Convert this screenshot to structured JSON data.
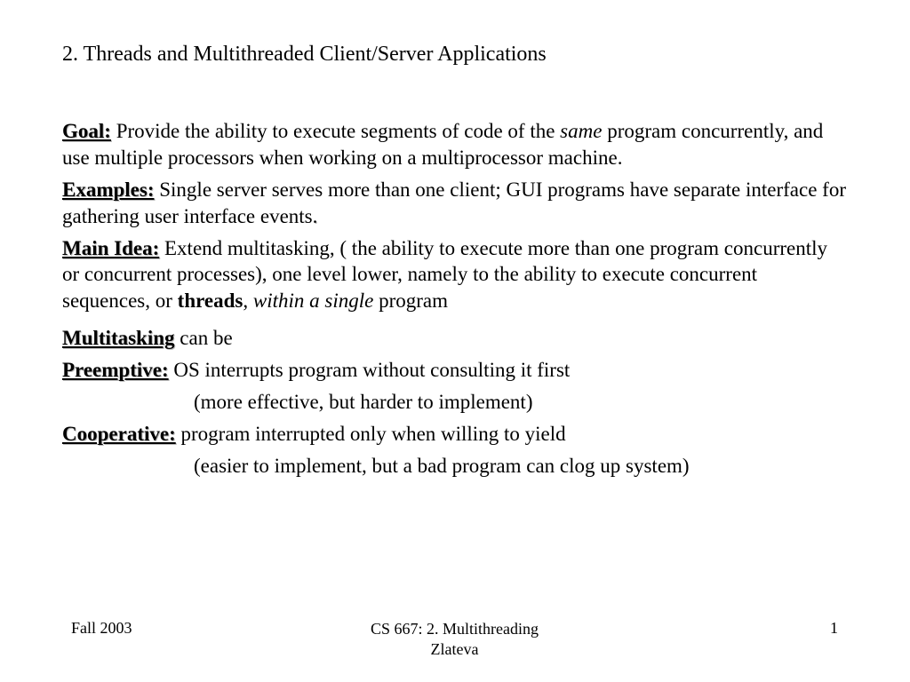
{
  "title": "2. Threads  and Multithreaded Client/Server Applications",
  "goal": {
    "label": "Goal:",
    "text_pre": " Provide the ability to execute segments of code of the ",
    "em": "same",
    "text_post": " program concurrently, and use multiple processors when working on a multiprocessor machine."
  },
  "examples": {
    "label": "Examples:",
    "text": " Single server serves more than one client; GUI programs have separate interface for gathering user interface events",
    "period": "."
  },
  "mainidea": {
    "label": "Main Idea:",
    "text_pre": "  Extend multitasking, ( the ability to execute more than one program concurrently or concurrent processes), one level lower, namely to the ability to execute concurrent sequences, or ",
    "bold": "threads",
    "mid": ",  ",
    "em": "within a single",
    "text_post": " program"
  },
  "multitasking": {
    "label": "Multitasking",
    "text": " can be"
  },
  "preemptive": {
    "label": "Preemptive:",
    "line1": "   OS interrupts program without consulting it first",
    "line2": "(more effective, but harder to implement)"
  },
  "cooperative": {
    "label": "Cooperative:",
    "line1": "  program interrupted only when willing to yield",
    "line2": "(easier to implement, but a bad program can clog up system)"
  },
  "footer": {
    "left": "Fall 2003",
    "center1": "CS 667: 2. Multithreading",
    "center2": "Zlateva",
    "right": "1"
  }
}
